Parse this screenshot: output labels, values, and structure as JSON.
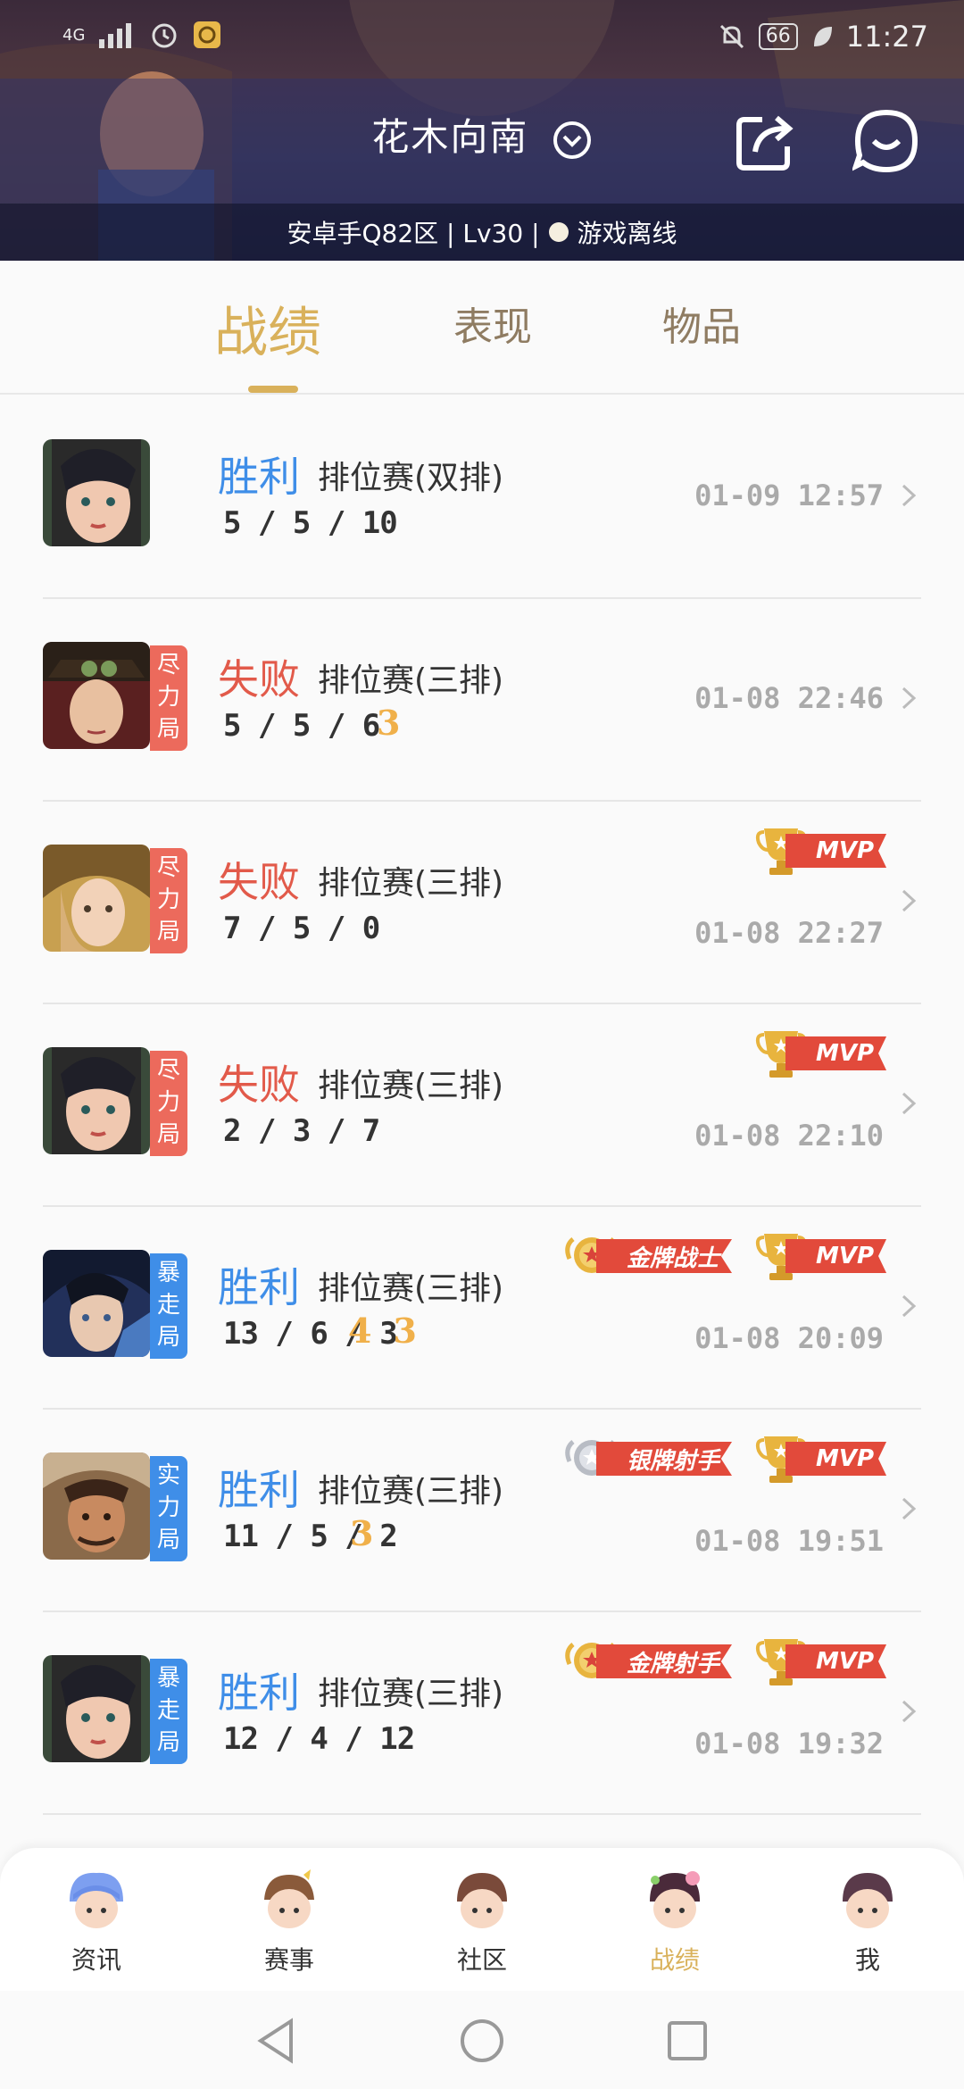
{
  "status_bar": {
    "network": "4G",
    "battery": "66",
    "time": "11:27"
  },
  "header": {
    "player_name": "花木向南",
    "server_info": "安卓手Q82区 | Lv30 |",
    "online_status": "游戏离线"
  },
  "tabs": [
    "战绩",
    "表现",
    "物品"
  ],
  "matches": [
    {
      "result": "胜利",
      "mode": "排位赛(双排)",
      "kda": "5 / 5 / 10",
      "time": "01-09 12:57",
      "streaks": [],
      "tag": "",
      "badges": []
    },
    {
      "result": "失败",
      "mode": "排位赛(三排)",
      "kda": "5 / 5 / 6",
      "time": "01-08 22:46",
      "streaks": [
        "3"
      ],
      "tag": "尽力局",
      "badges": []
    },
    {
      "result": "失败",
      "mode": "排位赛(三排)",
      "kda": "7 / 5 / 0",
      "time": "01-08 22:27",
      "streaks": [],
      "tag": "尽力局",
      "badges": [
        "MVP"
      ]
    },
    {
      "result": "失败",
      "mode": "排位赛(三排)",
      "kda": "2 / 3 / 7",
      "time": "01-08 22:10",
      "streaks": [],
      "tag": "尽力局",
      "badges": [
        "MVP"
      ]
    },
    {
      "result": "胜利",
      "mode": "排位赛(三排)",
      "kda": "13 / 6 / 3",
      "time": "01-08 20:09",
      "streaks": [
        "4",
        "3"
      ],
      "tag": "暴走局",
      "badges": [
        "金牌战士",
        "MVP"
      ]
    },
    {
      "result": "胜利",
      "mode": "排位赛(三排)",
      "kda": "11 / 5 / 2",
      "time": "01-08 19:51",
      "streaks": [
        "3"
      ],
      "tag": "实力局",
      "badges": [
        "银牌射手",
        "MVP"
      ]
    },
    {
      "result": "胜利",
      "mode": "排位赛(三排)",
      "kda": "12 / 4 / 12",
      "time": "01-08 19:32",
      "streaks": [],
      "tag": "暴走局",
      "badges": [
        "金牌射手",
        "MVP"
      ]
    }
  ],
  "bottom_nav": [
    "资讯",
    "赛事",
    "社区",
    "战绩",
    "我"
  ],
  "colors": {
    "gold": "#d9b15b",
    "win": "#3f8ee8",
    "lose": "#e25a4a",
    "mvp_red": "#e24a3b"
  }
}
